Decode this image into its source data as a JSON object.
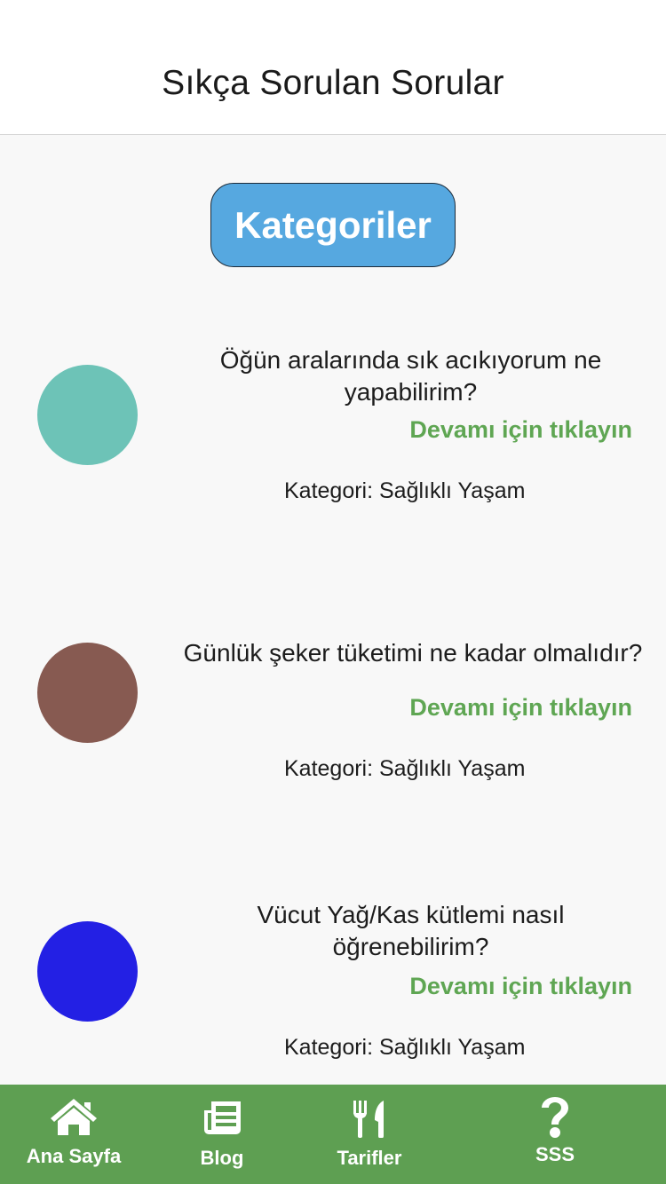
{
  "header": {
    "title": "Sıkça Sorulan Sorular"
  },
  "categories_button": {
    "label": "Kategoriler",
    "color": "#56a8e0"
  },
  "faq_items": [
    {
      "question_line1": "Öğün aralarında sık acıkıyorum ne",
      "question_line2": "yapabilirim?",
      "more_label": "Devamı için tıklayın",
      "category": "Kategori: Sağlıklı Yaşam",
      "avatar_color": "#6dc3b7"
    },
    {
      "question_line1": "Günlük şeker tüketimi ne kadar olmalıdır?",
      "question_line2": "",
      "more_label": "Devamı için tıklayın",
      "category": "Kategori: Sağlıklı Yaşam",
      "avatar_color": "#875a51"
    },
    {
      "question_line1": "Vücut Yağ/Kas kütlemi nasıl",
      "question_line2": "öğrenebilirim?",
      "more_label": "Devamı için tıklayın",
      "category": "Kategori: Sağlıklı Yaşam",
      "avatar_color": "#2320e4"
    }
  ],
  "bottom_nav": {
    "background_color": "#5e9f52",
    "items": [
      {
        "label": "Ana Sayfa",
        "icon": "home-icon"
      },
      {
        "label": "Blog",
        "icon": "newspaper-icon"
      },
      {
        "label": "Tarifler",
        "icon": "utensils-icon"
      },
      {
        "label": "SSS",
        "icon": "question-icon"
      }
    ]
  },
  "colors": {
    "accent_link": "#5fa653",
    "status_indicator": "#e06060"
  }
}
